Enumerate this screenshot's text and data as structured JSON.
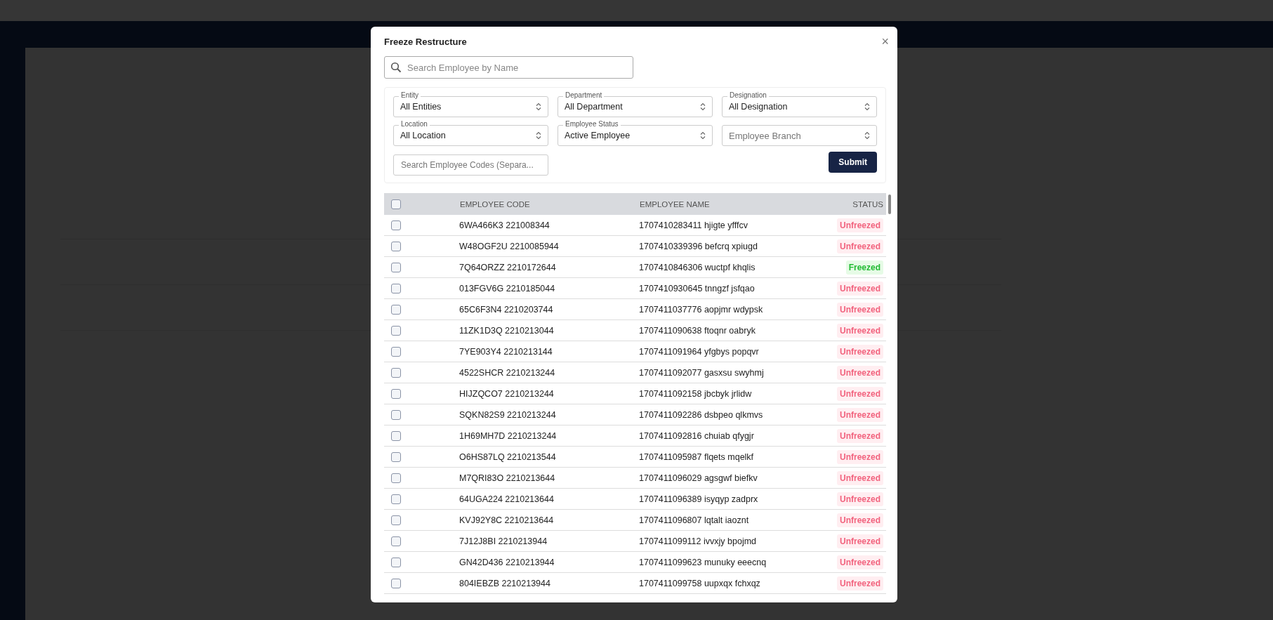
{
  "dialog": {
    "title": "Freeze Restructure",
    "close": "×",
    "search": {
      "placeholder": "Search Employee by Name"
    },
    "filters": [
      {
        "label": "Entity",
        "value": "All Entities"
      },
      {
        "label": "Department",
        "value": "All Department"
      },
      {
        "label": "Designation",
        "value": "All Designation"
      },
      {
        "label": "Location",
        "value": "All Location"
      },
      {
        "label": "Employee Status",
        "value": "Active Employee"
      },
      {
        "placeholder": "Employee Branch"
      }
    ],
    "codes_search": {
      "placeholder": "Search Employee Codes (Separa..."
    },
    "submit": "Submit",
    "table": {
      "select_all": {
        "checked": false
      },
      "columns": [
        "EMPLOYEE CODE",
        "EMPLOYEE NAME",
        "STATUS"
      ],
      "rows": [
        {
          "code": "6WA466K3 221008344",
          "name": "1707410283411 hjigte yfffcv",
          "status": "Unfreezed",
          "kind": "unfrozen",
          "checked": false
        },
        {
          "code": "W48OGF2U 2210085944",
          "name": "1707410339396 befcrq xpiugd",
          "status": "Unfreezed",
          "kind": "unfrozen",
          "checked": false
        },
        {
          "code": "7Q64ORZZ 2210172644",
          "name": "1707410846306 wuctpf khqlis",
          "status": "Freezed",
          "kind": "frozen",
          "checked": false
        },
        {
          "code": "013FGV6G 2210185044",
          "name": "1707410930645 tnngzf jsfqao",
          "status": "Unfreezed",
          "kind": "unfrozen",
          "checked": false
        },
        {
          "code": "65C6F3N4 2210203744",
          "name": "1707411037776 aopjmr wdypsk",
          "status": "Unfreezed",
          "kind": "unfrozen",
          "checked": false
        },
        {
          "code": "11ZK1D3Q 2210213044",
          "name": "1707411090638 ftoqnr oabryk",
          "status": "Unfreezed",
          "kind": "unfrozen",
          "checked": false
        },
        {
          "code": "7YE903Y4 2210213144",
          "name": "1707411091964 yfgbys popqvr",
          "status": "Unfreezed",
          "kind": "unfrozen",
          "checked": false
        },
        {
          "code": "4522SHCR 2210213244",
          "name": "1707411092077 gasxsu swyhmj",
          "status": "Unfreezed",
          "kind": "unfrozen",
          "checked": false
        },
        {
          "code": "HIJZQCO7 2210213244",
          "name": "1707411092158 jbcbyk jrlidw",
          "status": "Unfreezed",
          "kind": "unfrozen",
          "checked": false
        },
        {
          "code": "SQKN82S9 2210213244",
          "name": "1707411092286 dsbpeo qlkmvs",
          "status": "Unfreezed",
          "kind": "unfrozen",
          "checked": false
        },
        {
          "code": "1H69MH7D 2210213244",
          "name": "1707411092816 chuiab qfygjr",
          "status": "Unfreezed",
          "kind": "unfrozen",
          "checked": false
        },
        {
          "code": "O6HS87LQ 2210213544",
          "name": "1707411095987 flqets mqelkf",
          "status": "Unfreezed",
          "kind": "unfrozen",
          "checked": false
        },
        {
          "code": "M7QRI83O 2210213644",
          "name": "1707411096029 agsgwf biefkv",
          "status": "Unfreezed",
          "kind": "unfrozen",
          "checked": false
        },
        {
          "code": "64UGA224 2210213644",
          "name": "1707411096389 isyqyp zadprx",
          "status": "Unfreezed",
          "kind": "unfrozen",
          "checked": false
        },
        {
          "code": "KVJ92Y8C 2210213644",
          "name": "1707411096807 lqtalt iaoznt",
          "status": "Unfreezed",
          "kind": "unfrozen",
          "checked": false
        },
        {
          "code": "7J12J8BI 2210213944",
          "name": "1707411099112 ivvxjy bpojmd",
          "status": "Unfreezed",
          "kind": "unfrozen",
          "checked": false
        },
        {
          "code": "GN42D436 2210213944",
          "name": "1707411099623 munuky eeecnq",
          "status": "Unfreezed",
          "kind": "unfrozen",
          "checked": false
        },
        {
          "code": "804IEBZB 2210213944",
          "name": "1707411099758 uupxqx fchxqz",
          "status": "Unfreezed",
          "kind": "unfrozen",
          "checked": false
        }
      ]
    }
  }
}
